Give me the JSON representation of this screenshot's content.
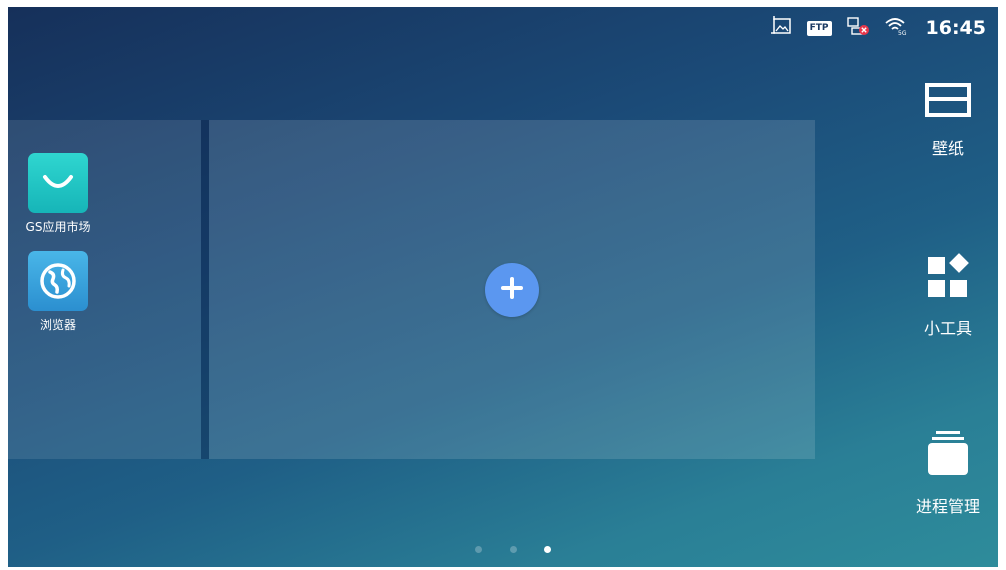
{
  "status_bar": {
    "time": "16:45",
    "ftp_badge": "FTP",
    "icons": [
      "screenshot-icon",
      "ftp-icon",
      "network-disconnected-icon",
      "wifi-5g-icon"
    ]
  },
  "apps": [
    {
      "label": "GS应用市场",
      "icon": "app-market-icon"
    },
    {
      "label": "浏览器",
      "icon": "browser-globe-icon"
    }
  ],
  "side_menu": {
    "wallpaper": {
      "label": "壁纸",
      "icon": "wallpaper-icon"
    },
    "widgets": {
      "label": "小工具",
      "icon": "widgets-icon"
    },
    "process_manager": {
      "label": "进程管理",
      "icon": "process-manager-icon"
    }
  },
  "add_panel": {
    "icon": "plus-icon"
  },
  "pager": {
    "count": 3,
    "active_index": 2
  },
  "colors": {
    "add_button": "#5b97f0",
    "market_icon": "#1fc4c4",
    "browser_icon": "#3aa3de",
    "background_top": "#16305a",
    "background_bottom": "#2e8c9b"
  }
}
